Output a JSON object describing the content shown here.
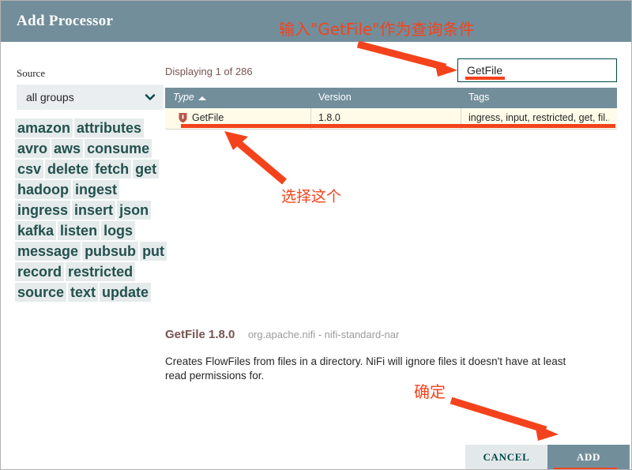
{
  "dialog": {
    "title": "Add Processor"
  },
  "sidebar": {
    "source_label": "Source",
    "source_value": "all groups",
    "chevron_icon": "chevron-down-icon",
    "tags": [
      "amazon",
      "attributes",
      "avro",
      "aws",
      "consume",
      "csv",
      "delete",
      "fetch",
      "get",
      "hadoop",
      "ingest",
      "ingress",
      "insert",
      "json",
      "kafka",
      "listen",
      "logs",
      "message",
      "pubsub",
      "put",
      "record",
      "restricted",
      "source",
      "text",
      "update"
    ]
  },
  "main": {
    "displaying": "Displaying 1 of 286",
    "search": {
      "value": "GetFile",
      "placeholder": ""
    },
    "table": {
      "columns": [
        "Type",
        "Version",
        "Tags"
      ],
      "sort_column": "Type",
      "sort_direction": "asc",
      "sort_icon": "caret-up-icon",
      "rows": [
        {
          "icon": "restricted-shield-icon",
          "type": "GetFile",
          "version": "1.8.0",
          "tags": "ingress, input, restricted, get, fil..."
        }
      ]
    },
    "detail": {
      "title": "GetFile 1.8.0",
      "bundle": "org.apache.nifi - nifi-standard-nar",
      "description": "Creates FlowFiles from files in a directory. NiFi will ignore files it doesn't have at least read permissions for."
    }
  },
  "footer": {
    "cancel_label": "CANCEL",
    "add_label": "ADD"
  },
  "annotations": {
    "top": "输入\"GetFile\"作为查询条件",
    "select_row": "选择这个",
    "confirm": "确定",
    "color": "#f4431c"
  },
  "colors": {
    "header_bar": "#728e9b",
    "tag_bg": "#e5eaea",
    "tag_text": "#23514f",
    "row_highlight": "#fffbe8",
    "accent_text": "#775351"
  }
}
